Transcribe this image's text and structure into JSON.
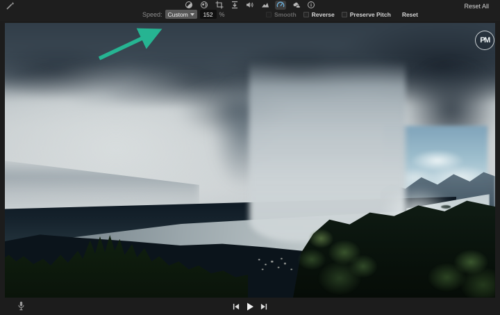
{
  "top_toolbar": {
    "reset_all_label": "Reset All",
    "selected_tool": "speed",
    "tool_order": [
      "enhance",
      "color-correction",
      "color-balance",
      "crop",
      "stabilization",
      "volume",
      "noise-reduction",
      "speed",
      "effects",
      "info"
    ]
  },
  "speed_panel": {
    "label": "Speed:",
    "preset_value": "Custom",
    "rate_value": "152",
    "rate_unit": "%",
    "checkboxes": [
      {
        "label": "Smooth",
        "checked": false,
        "enabled": false
      },
      {
        "label": "Reverse",
        "checked": false,
        "enabled": true
      },
      {
        "label": "Preserve Pitch",
        "checked": false,
        "enabled": true
      }
    ],
    "reset_label": "Reset"
  },
  "viewer": {
    "watermark_text": "PM",
    "scene_description": "timelapse storm cloud with rain shaft over mountain lake and forested hills"
  },
  "icons": {
    "enhance": "magic-wand",
    "color-correction": "half-filled-circle",
    "color-balance": "circle-swirl",
    "crop": "crop-corners",
    "stabilization": "arrow-down-between-bars",
    "volume": "speaker-with-waves",
    "noise-reduction": "mountain-ramp",
    "speed": "speedometer-gauge",
    "effects": "clouds",
    "info": "circle-i",
    "microphone": "mic",
    "previous": "skip-to-start",
    "play": "play-triangle",
    "next": "skip-to-end"
  },
  "colors": {
    "annotation_arrow": "#26b492",
    "selected_tool_glyph": "#6db3e0",
    "toolbar_bg": "#1e1e1e",
    "icon_gray": "#b4b4b4"
  }
}
